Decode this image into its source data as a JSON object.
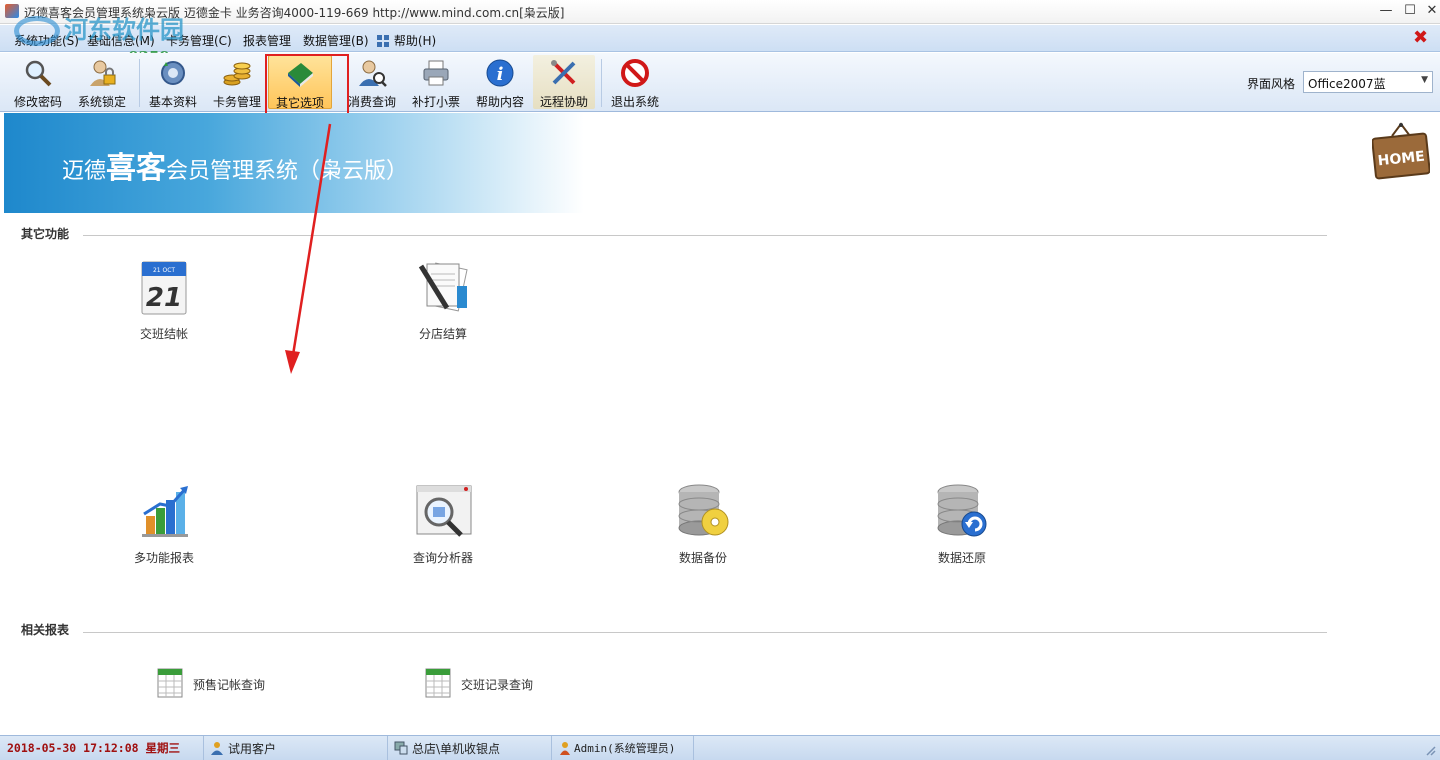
{
  "window": {
    "title": "迈德喜客会员管理系统枭云版  迈德金卡  业务咨询4000-119-669  http://www.mind.com.cn[枭云版]",
    "min": "—",
    "max": "☐",
    "close": "✕"
  },
  "watermark": {
    "line1": "河东软件园",
    "line2": "www.pc0359.cn"
  },
  "menu": {
    "items": [
      "系统功能(S)",
      "基础信息(M)",
      "卡务管理(C)",
      "报表管理",
      "数据管理(B)",
      "帮助(H)"
    ],
    "close_glyph": "✖"
  },
  "toolbar": {
    "tools": [
      "修改密码",
      "系统锁定",
      "基本资料",
      "卡务管理",
      "其它选项",
      "消费查询",
      "补打小票",
      "帮助内容",
      "远程协助",
      "退出系统"
    ],
    "style_label": "界面风格",
    "style_value": "Office2007蓝",
    "caret": "▼"
  },
  "banner": {
    "prefix": "迈德",
    "emphasis": "喜客",
    "suffix": "会员管理系统（枭云版）",
    "home": "HOME"
  },
  "sections": {
    "other_title": "其它功能",
    "reports_title": "相关报表"
  },
  "functions": {
    "shift_settle": "交班结帐",
    "calendar_day": "21",
    "calendar_month": "21 OCT",
    "branch_settle": "分店结算",
    "multi_report": "多功能报表",
    "query_analyzer": "查询分析器",
    "data_backup": "数据备份",
    "data_restore": "数据还原"
  },
  "reports": {
    "presale": "预售记帐查询",
    "shift_records": "交班记录查询"
  },
  "status": {
    "datetime": "2018-05-30 17:12:08 星期三",
    "customer": "试用客户",
    "store": "总店\\单机收银点",
    "user": "Admin(系统管理员)"
  },
  "colors": {
    "accent": "#1e88cc",
    "highlight_box": "#e02020",
    "active_tool": "#ffc55a"
  }
}
